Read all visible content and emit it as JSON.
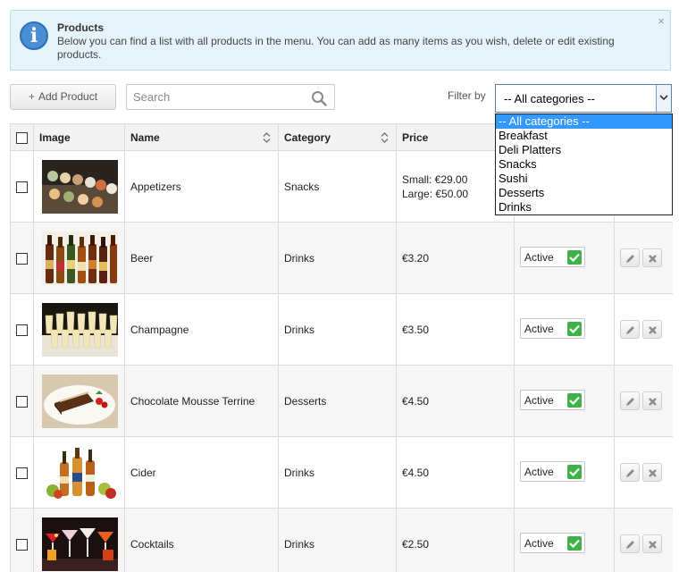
{
  "info": {
    "title": "Products",
    "text": "Below you can find a list with all products in the menu. You can add as many items as you wish, delete or edit existing products.",
    "close": "×"
  },
  "toolbar": {
    "add_label": "Add Product",
    "search_placeholder": "Search",
    "filter_label": "Filter by",
    "filter_selected": "-- All categories --",
    "filter_options": [
      "-- All categories --",
      "Breakfast",
      "Deli Platters",
      "Snacks",
      "Sushi",
      "Desserts",
      "Drinks"
    ]
  },
  "table": {
    "headers": {
      "image": "Image",
      "name": "Name",
      "category": "Category",
      "price": "Price"
    },
    "rows": [
      {
        "name": "Appetizers",
        "category": "Snacks",
        "price": [
          "Small: €29.00",
          "Large: €50.00"
        ],
        "status": ""
      },
      {
        "name": "Beer",
        "category": "Drinks",
        "price": [
          "€3.20"
        ],
        "status": "Active"
      },
      {
        "name": "Champagne",
        "category": "Drinks",
        "price": [
          "€3.50"
        ],
        "status": "Active"
      },
      {
        "name": "Chocolate Mousse Terrine",
        "category": "Desserts",
        "price": [
          "€4.50"
        ],
        "status": "Active"
      },
      {
        "name": "Cider",
        "category": "Drinks",
        "price": [
          "€4.50"
        ],
        "status": "Active"
      },
      {
        "name": "Cocktails",
        "category": "Drinks",
        "price": [
          "€2.50"
        ],
        "status": "Active"
      }
    ]
  },
  "colors": {
    "accent": "#3399ff",
    "active_check": "#3fb34a",
    "banner_bg": "#e6f3fb"
  },
  "icons": {
    "info": "info-icon",
    "search": "search-icon",
    "sort": "sort-icon",
    "edit": "pencil-icon",
    "delete": "x-icon",
    "check": "check-icon"
  }
}
